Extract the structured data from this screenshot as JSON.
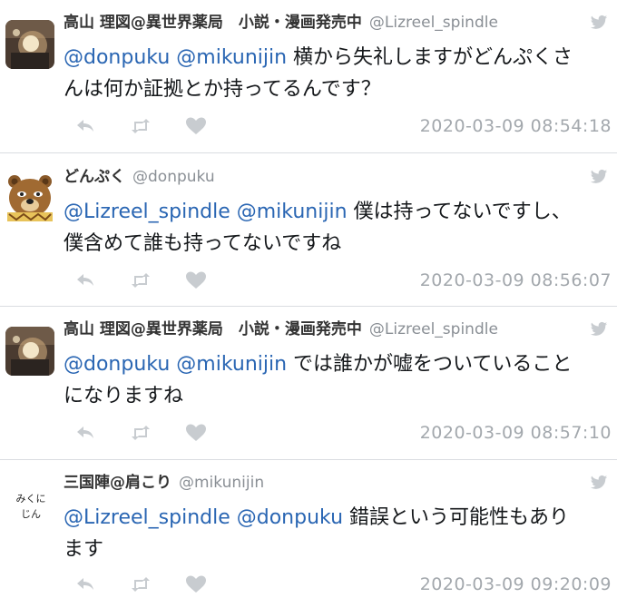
{
  "tweets": [
    {
      "name": "高山 理図@異世界薬局　小説・漫画発売中",
      "handle": "@Lizreel_spindle",
      "mentions": "@donpuku @mikunijin",
      "text_line1": " 横から失礼しますがどんぷくさ",
      "text_line2": "んは何か証拠とか持ってるんです？",
      "timestamp": "2020-03-09 08:54:18"
    },
    {
      "name": "どんぷく",
      "handle": "@donpuku",
      "mentions": "@Lizreel_spindle @mikunijin",
      "text_line1": " 僕は持ってないですし、",
      "text_line2": "僕含めて誰も持ってないですね",
      "timestamp": "2020-03-09 08:56:07"
    },
    {
      "name": "高山 理図@異世界薬局　小説・漫画発売中",
      "handle": "@Lizreel_spindle",
      "mentions": "@donpuku @mikunijin",
      "text_line1": " では誰かが嘘をついていること",
      "text_line2": "になりますね",
      "timestamp": "2020-03-09 08:57:10"
    },
    {
      "name": "三国陣@肩こり",
      "handle": "@mikunijin",
      "mentions": "@Lizreel_spindle @donpuku",
      "text_line1": " 錯誤という可能性もあり",
      "text_line2": "ます",
      "timestamp": "2020-03-09 09:20:09",
      "avatar_text_line1": "みくに",
      "avatar_text_line2": "じん"
    }
  ],
  "colors": {
    "mention": "#2a66b3",
    "icon_gray": "#c8ccd0",
    "timestamp": "#a3a8ad"
  },
  "icons": [
    "reply-icon",
    "retweet-icon",
    "like-icon",
    "twitter-bird-icon"
  ]
}
